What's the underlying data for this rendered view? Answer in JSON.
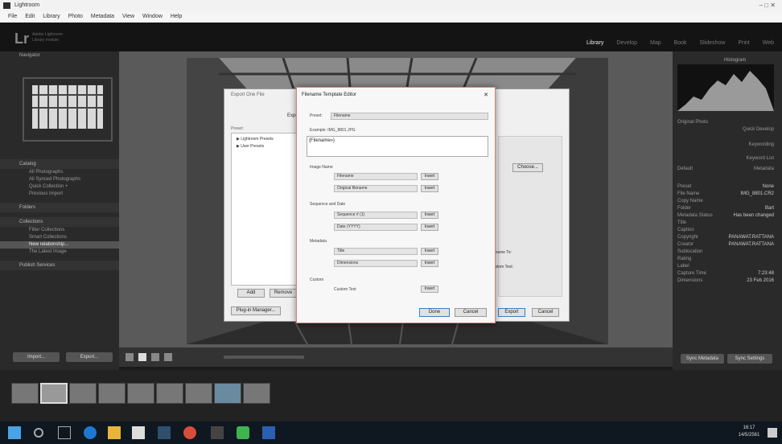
{
  "window": {
    "title": "Lightroom",
    "controls": "–   □   ✕"
  },
  "menu": [
    "File",
    "Edit",
    "Library",
    "Photo",
    "Metadata",
    "View",
    "Window",
    "Help"
  ],
  "identity": {
    "logo": "Lr",
    "line1": "Adobe Lightroom",
    "line2": "Library module"
  },
  "modules": {
    "items": [
      "Library",
      "Develop",
      "Map",
      "Book",
      "Slideshow",
      "Print",
      "Web"
    ],
    "active": "Library"
  },
  "left_panel": {
    "navigator": "Navigator",
    "catalog_header": "Catalog",
    "catalog_items": [
      "All Photographs",
      "All Synced Photographs",
      "Quick Collection +",
      "Previous Import"
    ],
    "folders_header": "Folders",
    "collections_header": "Collections",
    "collection_items": [
      "Filter Collections",
      "Smart Collections",
      "New relationship...",
      "The Latest Image"
    ],
    "publish_header": "Publish Services",
    "import_label": "Import...",
    "export_label": "Export..."
  },
  "right_panel": {
    "histogram": "Histogram",
    "original_photo": "Original Photo",
    "quick_develop": "Quick Develop",
    "keywording": "Keywording",
    "keyword_list": "Keyword List",
    "metadata": "Metadata",
    "default": "Default",
    "rows": [
      "Preset",
      "File Name",
      "Copy Name",
      "Folder",
      "Metadata Status",
      "Title",
      "Caption",
      "Copyright",
      "Creator",
      "Sublocation",
      "Rating",
      "Label",
      "Capture Time",
      "Dimensions"
    ],
    "values": [
      "None",
      "IMG_8801.CR2",
      "",
      "Bart",
      "Has been changed",
      "",
      "",
      "PANAWAT.RATTANA",
      "PANAWAT.RATTANA",
      "",
      "",
      "",
      "7:23:48",
      "23 Feb 2016"
    ],
    "sync_metadata": "Sync Metadata",
    "sync_settings": "Sync Settings"
  },
  "export_dialog": {
    "title": "Export One File",
    "export_to": "Export To:",
    "preset_header": "Preset:",
    "tree": [
      "Lightroom Presets",
      "User Presets"
    ],
    "choose": "Choose...",
    "add": "Add",
    "remove": "Remove",
    "plugin_manager": "Plug-in Manager...",
    "export_btn": "Export",
    "cancel_btn": "Cancel",
    "rename_to": "Rename To:",
    "custom_text": "Custom Text:"
  },
  "template_editor": {
    "title": "Filename Template Editor",
    "close": "✕",
    "preset_label": "Preset:",
    "preset_value": "Filename",
    "example_label": "Example: IMG_8801.JPG",
    "token": "{Filename»}",
    "image_name_header": "Image Name",
    "image_name_rows": [
      "Filename",
      "Original filename"
    ],
    "sequence_header": "Sequence and Date",
    "sequence_rows": [
      "Sequence # (1)",
      "Date (YYYY)"
    ],
    "metadata_header": "Metadata",
    "metadata_rows": [
      "Title",
      "Dimensions"
    ],
    "custom_header": "Custom",
    "custom_row": "Custom Text",
    "insert": "Insert",
    "done": "Done",
    "cancel": "Cancel"
  },
  "taskbar": {
    "time": "16:17",
    "date": "14/5/2561"
  }
}
